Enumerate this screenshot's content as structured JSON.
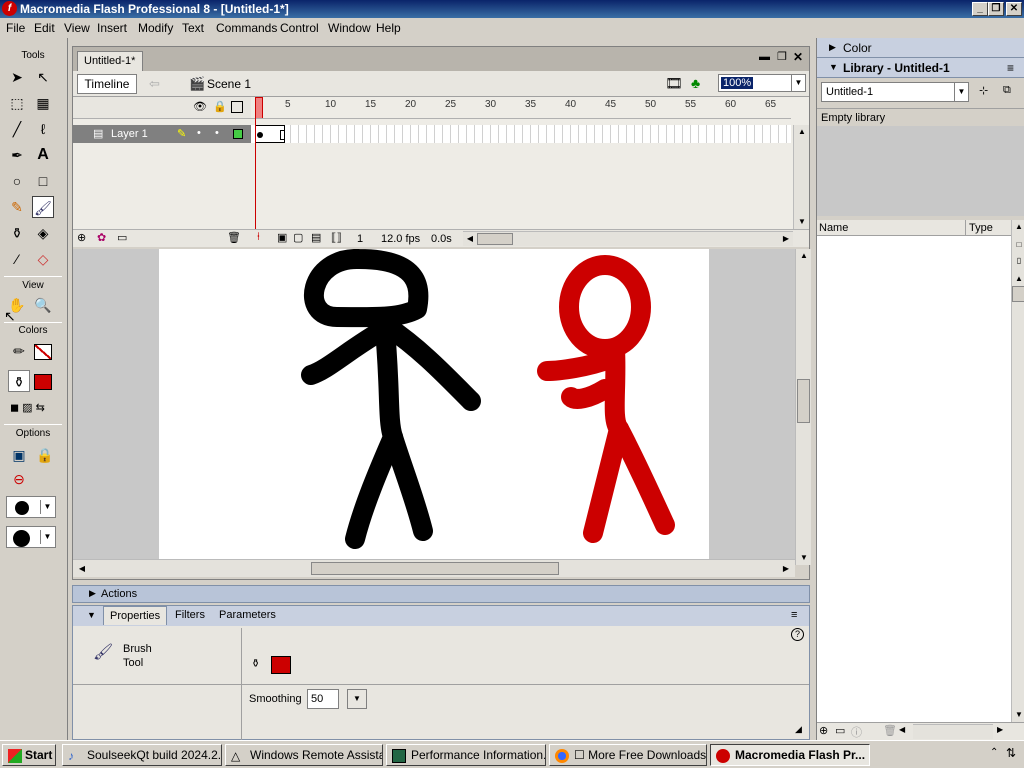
{
  "window": {
    "title": "Macromedia Flash Professional 8 - [Untitled-1*]"
  },
  "menu": [
    "File",
    "Edit",
    "View",
    "Insert",
    "Modify",
    "Text",
    "Commands",
    "Control",
    "Window",
    "Help"
  ],
  "tools": {
    "label": "Tools",
    "view_label": "View",
    "colors_label": "Colors",
    "options_label": "Options"
  },
  "document": {
    "tab_title": "Untitled-1*",
    "timeline_button": "Timeline",
    "scene_label": "Scene 1",
    "zoom": "100%",
    "layer_name": "Layer 1",
    "frame_numbers": [
      "5",
      "10",
      "15",
      "20",
      "25",
      "30",
      "35",
      "40",
      "45",
      "50",
      "55",
      "60",
      "65"
    ],
    "current_frame": "1",
    "fps": "12.0 fps",
    "elapsed": "0.0s"
  },
  "panels": {
    "actions_label": "Actions",
    "properties_tab": "Properties",
    "filters_tab": "Filters",
    "parameters_tab": "Parameters",
    "tool_name_line1": "Brush",
    "tool_name_line2": "Tool",
    "smoothing_label": "Smoothing",
    "smoothing_value": "50",
    "fill_color": "#cc0000"
  },
  "right": {
    "color_label": "Color",
    "library_label": "Library - Untitled-1",
    "library_select": "Untitled-1",
    "empty_library": "Empty library",
    "col_name": "Name",
    "col_type": "Type"
  },
  "taskbar": {
    "start": "Start",
    "tasks": [
      "SoulseekQt build 2024.2....",
      "Windows Remote Assista...",
      "Performance Information...",
      "☐ More Free Downloads....",
      "Macromedia Flash Pr..."
    ]
  }
}
